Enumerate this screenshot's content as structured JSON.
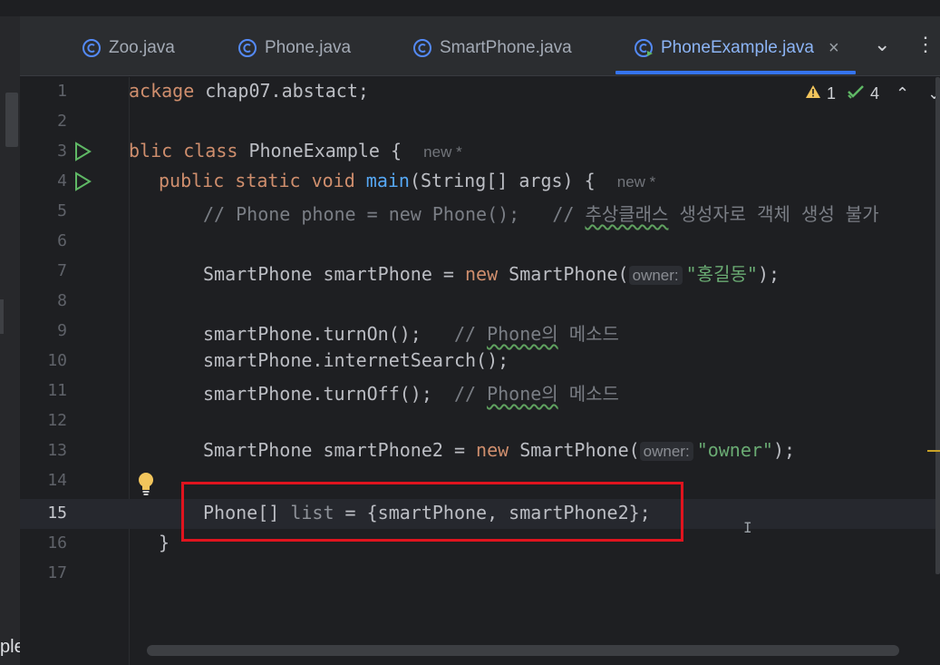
{
  "tabs": [
    {
      "label": "Zoo.java",
      "active": false
    },
    {
      "label": "Phone.java",
      "active": false
    },
    {
      "label": "SmartPhone.java",
      "active": false
    },
    {
      "label": "PhoneExample.java",
      "active": true
    }
  ],
  "tab_close": "×",
  "tab_menu": "⌄",
  "tab_more": "⋮",
  "inspections": {
    "warnings": "1",
    "ok": "4"
  },
  "lines": [
    {
      "n": "1",
      "package_kw": "ackage",
      "rest": " chap07.abstact;"
    },
    {
      "n": "2"
    },
    {
      "n": "3",
      "kw_public": "blic",
      "kw_class": "class",
      "name": " PhoneExample {",
      "ann": "new *"
    },
    {
      "n": "4",
      "mods": "public static void ",
      "fn": "main",
      "rest": "(String[] args) {",
      "ann": "new *"
    },
    {
      "n": "5",
      "comment_a": "// Phone phone = new Phone();   // ",
      "comment_sq": "추상클래스",
      "comment_b": " 생성자로 객체 생성 불가"
    },
    {
      "n": "6"
    },
    {
      "n": "7",
      "left": "SmartPhone smartPhone = ",
      "kw_new": "new",
      "mid": " SmartPhone(",
      "hint": "owner:",
      "str": "\"홍길동\"",
      "end": ");"
    },
    {
      "n": "8"
    },
    {
      "n": "9",
      "code": "smartPhone.turnOn();   ",
      "comment_a": "// ",
      "comment_sq": "Phone의",
      "comment_b": " 메소드"
    },
    {
      "n": "10",
      "code": "smartPhone.internetSearch();"
    },
    {
      "n": "11",
      "code": "smartPhone.turnOff();  ",
      "comment_a": "// ",
      "comment_sq": "Phone의",
      "comment_b": " 메소드"
    },
    {
      "n": "12"
    },
    {
      "n": "13",
      "left": "SmartPhone smartPhone2 = ",
      "kw_new": "new",
      "mid": " SmartPhone(",
      "hint": "owner:",
      "str": "\"owner\"",
      "end": ");"
    },
    {
      "n": "14"
    },
    {
      "n": "15",
      "type": "Phone[] ",
      "var": "list",
      "rest": " = {smartPhone, smartPhone2};"
    },
    {
      "n": "16",
      "code": "}"
    },
    {
      "n": "17"
    }
  ],
  "bottom_left_text": "ple",
  "colors": {
    "accent": "#3574f0",
    "highlight_box": "#e0141e"
  }
}
